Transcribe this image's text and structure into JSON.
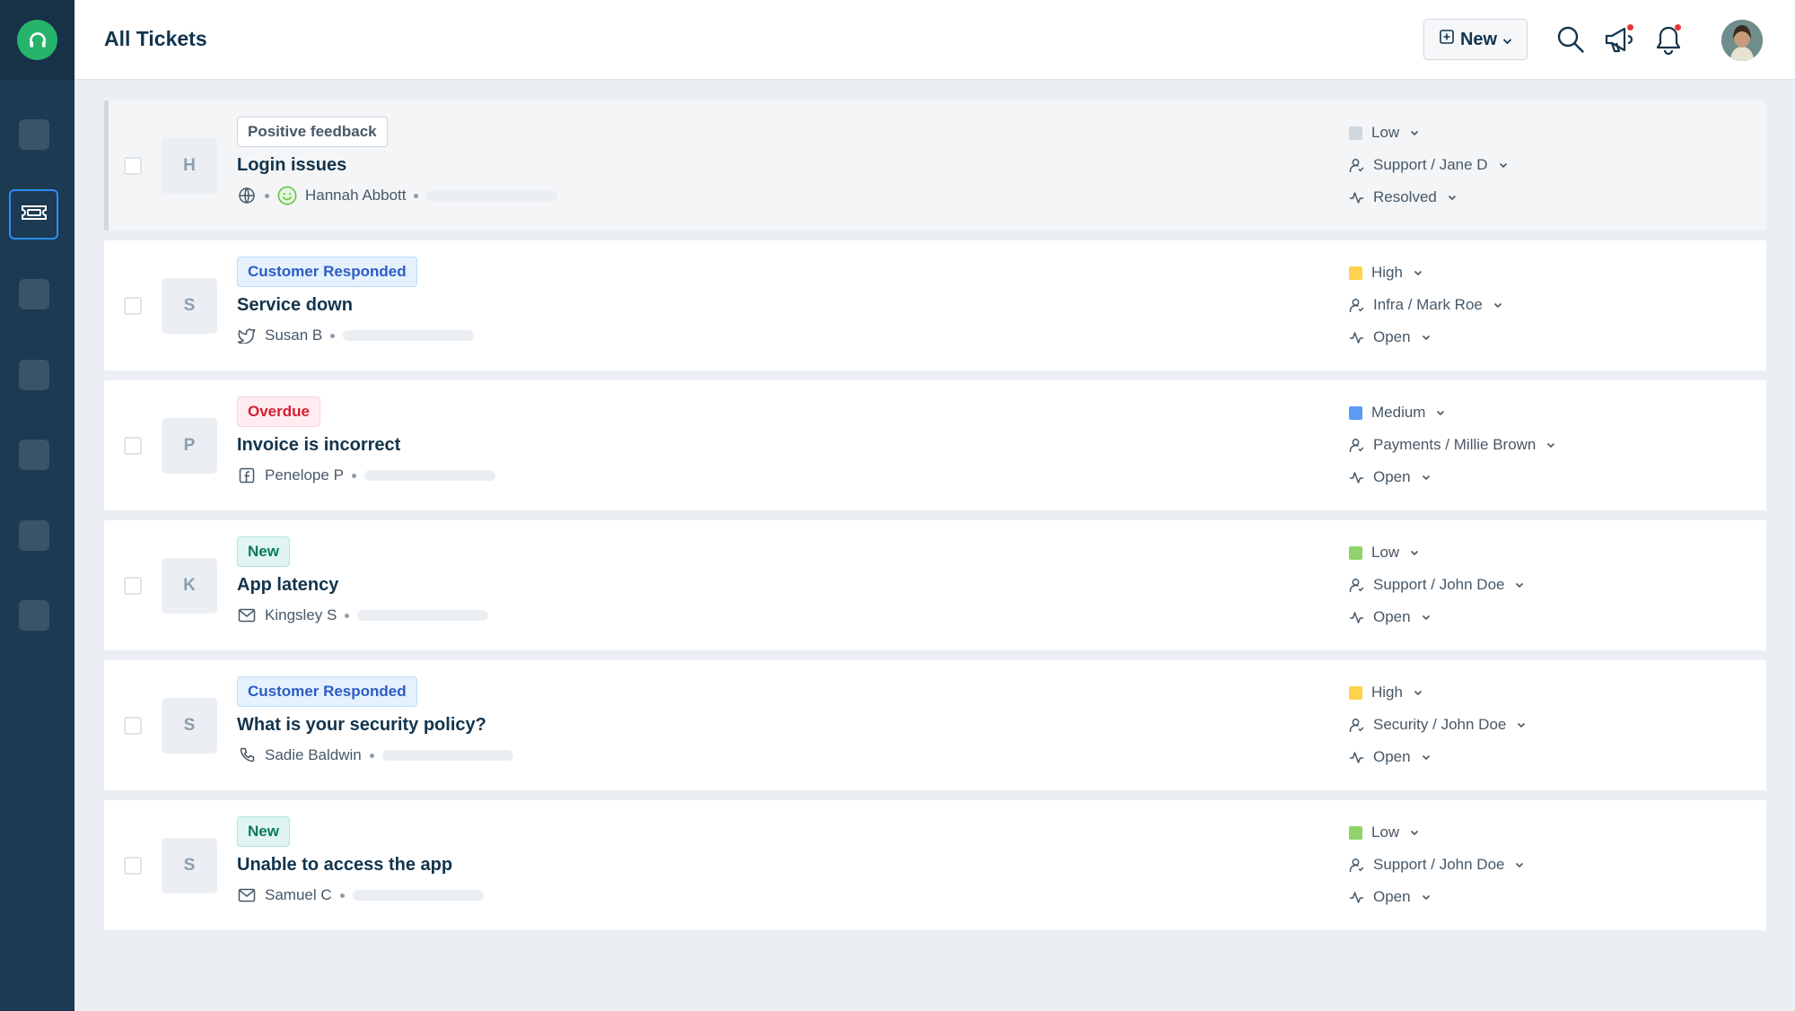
{
  "header": {
    "title": "All Tickets",
    "new_label": "New"
  },
  "colors": {
    "brand": "#26b36a",
    "sidebar": "#1c3a51",
    "priority_low": "#cfd7df",
    "priority_low_green": "#8fd46b",
    "priority_high": "#ffd24d",
    "priority_medium": "#5a9cf5"
  },
  "tickets": [
    {
      "initial": "H",
      "tag": "Positive feedback",
      "subject": "Login issues",
      "requester": "Hannah Abbott",
      "channel": "globe-icon",
      "priority": "Low",
      "group_agent": "Support / Jane D",
      "status": "Resolved"
    },
    {
      "initial": "S",
      "tag": "Customer Responded",
      "subject": "Service down",
      "requester": "Susan B",
      "channel": "twitter-icon",
      "priority": "High",
      "group_agent": "Infra / Mark Roe",
      "status": "Open"
    },
    {
      "initial": "P",
      "tag": "Overdue",
      "subject": "Invoice is incorrect",
      "requester": "Penelope P",
      "channel": "facebook-icon",
      "priority": "Medium",
      "group_agent": "Payments / Millie Brown",
      "status": "Open"
    },
    {
      "initial": "K",
      "tag": "New",
      "subject": "App latency",
      "requester": "Kingsley S",
      "channel": "email-icon",
      "priority": "Low",
      "group_agent": "Support / John Doe",
      "status": "Open"
    },
    {
      "initial": "S",
      "tag": "Customer Responded",
      "subject": "What is your security policy?",
      "requester": "Sadie Baldwin",
      "channel": "phone-icon",
      "priority": "High",
      "group_agent": "Security / John Doe",
      "status": "Open"
    },
    {
      "initial": "S",
      "tag": "New",
      "subject": "Unable to access the app",
      "requester": "Samuel C",
      "channel": "email-icon",
      "priority": "Low",
      "group_agent": "Support / John Doe",
      "status": "Open"
    }
  ]
}
